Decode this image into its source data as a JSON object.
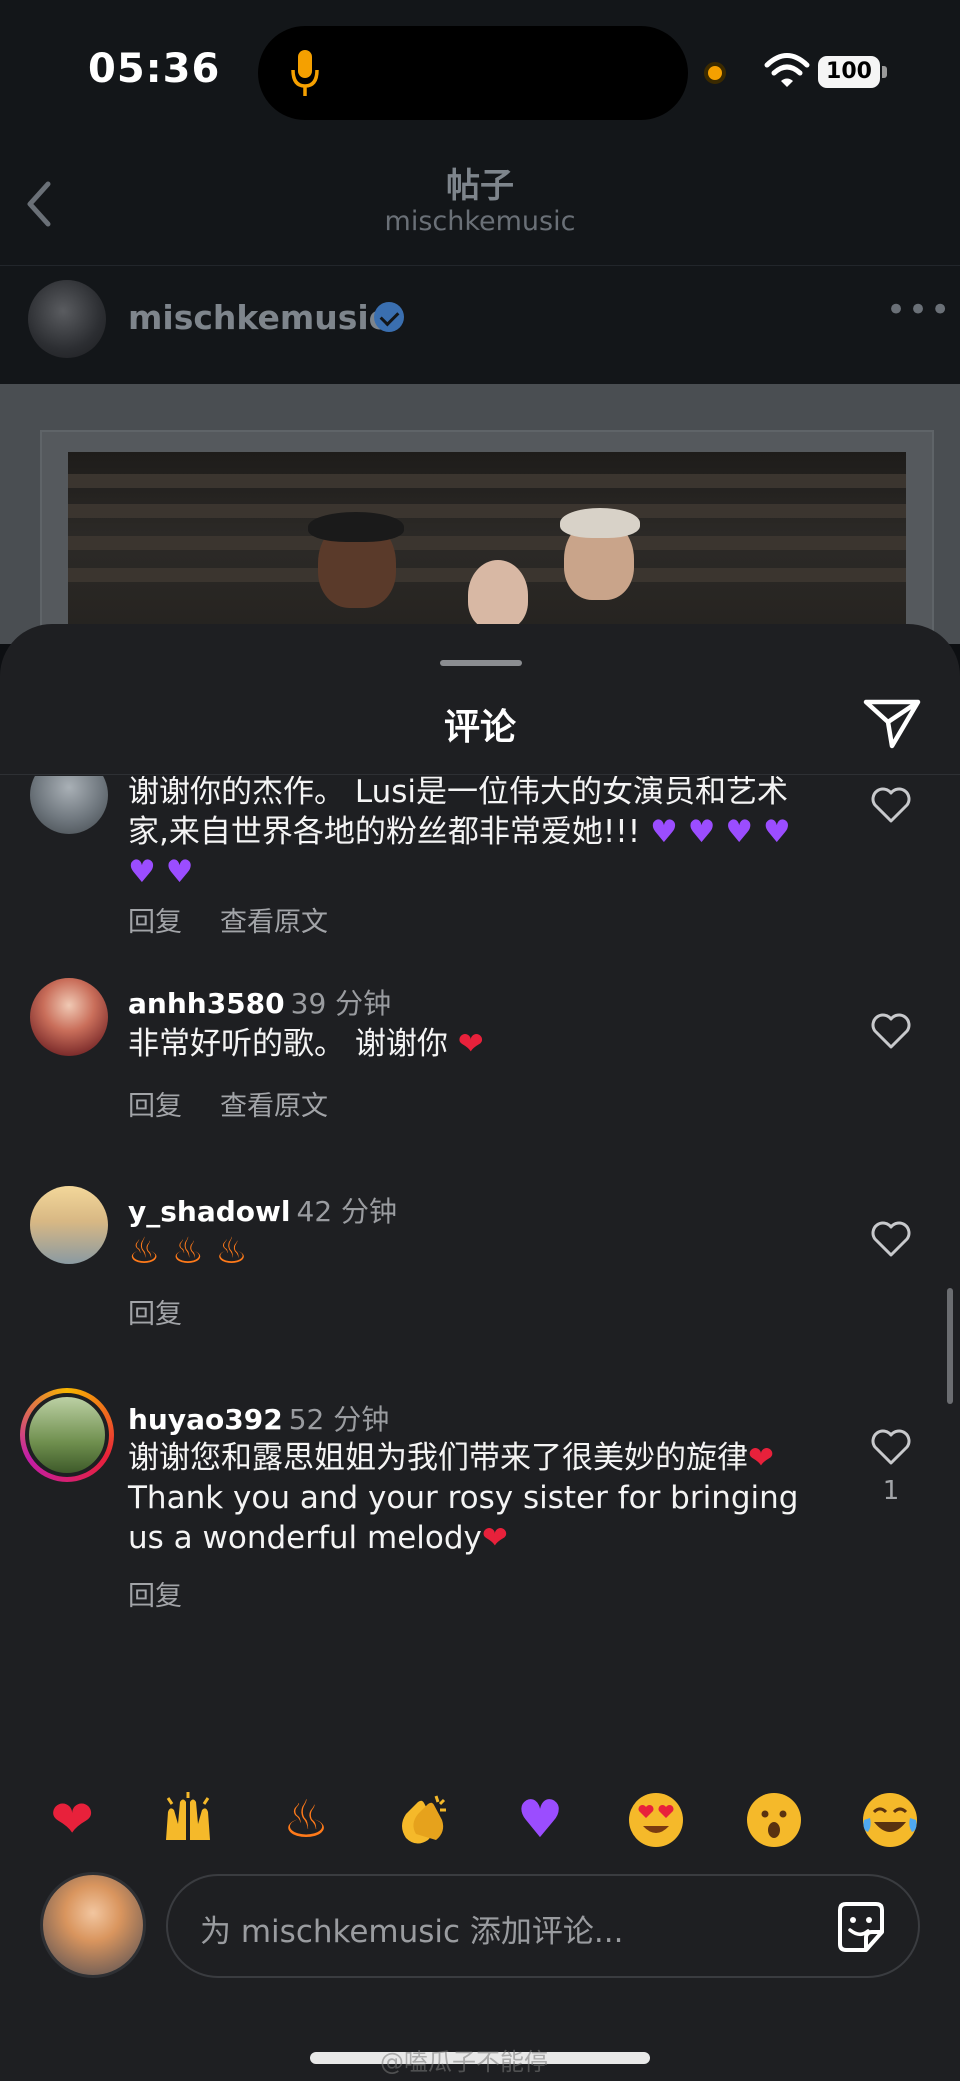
{
  "status_bar": {
    "time": "05:36",
    "battery": "100"
  },
  "nav": {
    "title": "帖子",
    "subtitle": "mischkemusic"
  },
  "author": {
    "username": "mischkemusic"
  },
  "sheet": {
    "title": "评论"
  },
  "comments": [
    {
      "username": "",
      "time": "",
      "text": "谢谢你的杰作。 Lusi是一位伟大的女演员和艺术家,来自世界各地的粉丝都非常爱她!!! 💜💜💜💜💜💜",
      "reply": "回复",
      "translate": "查看原文"
    },
    {
      "username": "anhh3580",
      "time": "39 分钟",
      "text": "非常好听的歌。 谢谢你 ❤",
      "reply": "回复",
      "translate": "查看原文"
    },
    {
      "username": "y_shadowl",
      "time": "42 分钟",
      "text": "🔥🔥🔥",
      "reply": "回复"
    },
    {
      "username": "huyao392",
      "time": "52 分钟",
      "text": "谢谢您和露思姐姐为我们带来了很美妙的旋律❤Thank you and your rosy sister for bringing us a wonderful melody❤",
      "reply": "回复",
      "likes": "1"
    }
  ],
  "emoji_bar": [
    "❤",
    "🙌",
    "🔥",
    "👏",
    "💜",
    "😍",
    "😮",
    "😂"
  ],
  "input": {
    "placeholder": "为 mischkemusic 添加评论..."
  },
  "watermark": "@嗑瓜子不能停",
  "colors": {
    "background": "#1e1f22",
    "accent_red": "#e8213b",
    "accent_purple": "#9b4dff",
    "verified_blue": "#3a6fb0"
  },
  "icons": [
    "mic-icon",
    "wifi-icon",
    "battery-icon",
    "back-icon",
    "verified-icon",
    "more-icon",
    "send-icon",
    "heart-icon",
    "sticker-icon"
  ]
}
